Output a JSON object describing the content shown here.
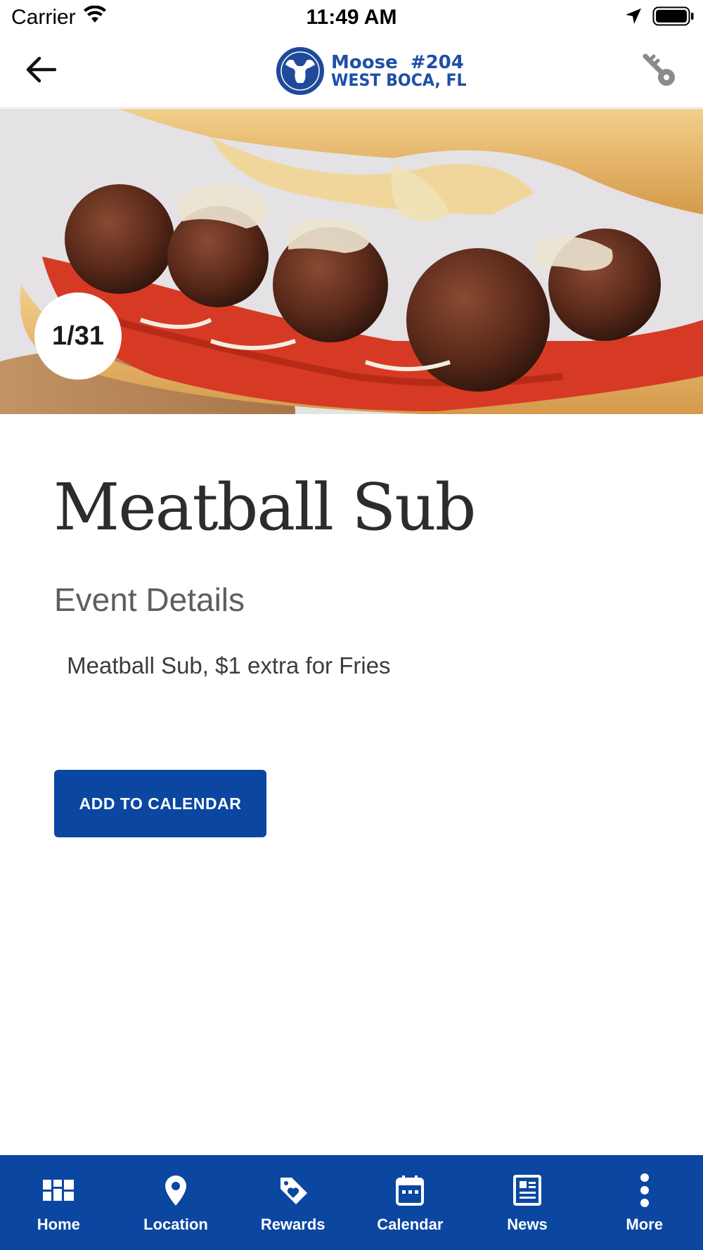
{
  "status_bar": {
    "carrier": "Carrier",
    "time": "11:49 AM"
  },
  "header": {
    "logo_line1": "Moose  #204",
    "logo_line2": "WEST BOCA, FL",
    "back_icon": "arrow-left-icon",
    "key_icon": "key-icon"
  },
  "hero": {
    "counter": "1/31"
  },
  "event": {
    "title": "Meatball Sub",
    "section_heading": "Event Details",
    "description": " Meatball Sub, $1 extra for Fries",
    "add_to_calendar_label": "ADD TO CALENDAR"
  },
  "tabs": [
    {
      "label": "Home",
      "icon": "grid-icon"
    },
    {
      "label": "Location",
      "icon": "map-pin-icon"
    },
    {
      "label": "Rewards",
      "icon": "tag-heart-icon"
    },
    {
      "label": "Calendar",
      "icon": "calendar-icon"
    },
    {
      "label": "News",
      "icon": "newspaper-icon"
    },
    {
      "label": "More",
      "icon": "more-vertical-icon"
    }
  ],
  "colors": {
    "brand_blue": "#0b47a1",
    "logo_blue": "#1e4fa8"
  }
}
